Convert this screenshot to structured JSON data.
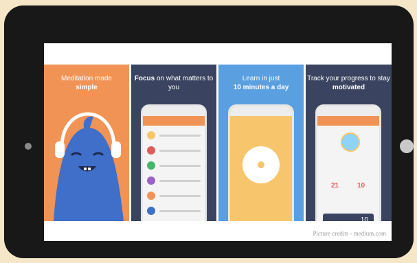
{
  "screen": {
    "panels": [
      {
        "pre": "Meditation made",
        "bold": "simple",
        "post": ""
      },
      {
        "pre": "",
        "bold": "Focus",
        "post": " on what matters to you"
      },
      {
        "pre": "Learn in just",
        "bold": "10 minutes a day",
        "post": ""
      },
      {
        "pre": "Track your progress to stay",
        "bold": "motivated",
        "post": ""
      }
    ],
    "stats": {
      "left": "21",
      "right": "10",
      "bottom": "10"
    },
    "credit": "Picture credits - medium.com"
  },
  "colors": {
    "orange": "#f29356",
    "navy": "#3a4460",
    "blue": "#5a9fe0",
    "monster": "#3f6fc9"
  },
  "icons": [
    "monster-mascot",
    "headphones-icon",
    "phone-mockup",
    "timer-icon",
    "avatar-icon"
  ]
}
